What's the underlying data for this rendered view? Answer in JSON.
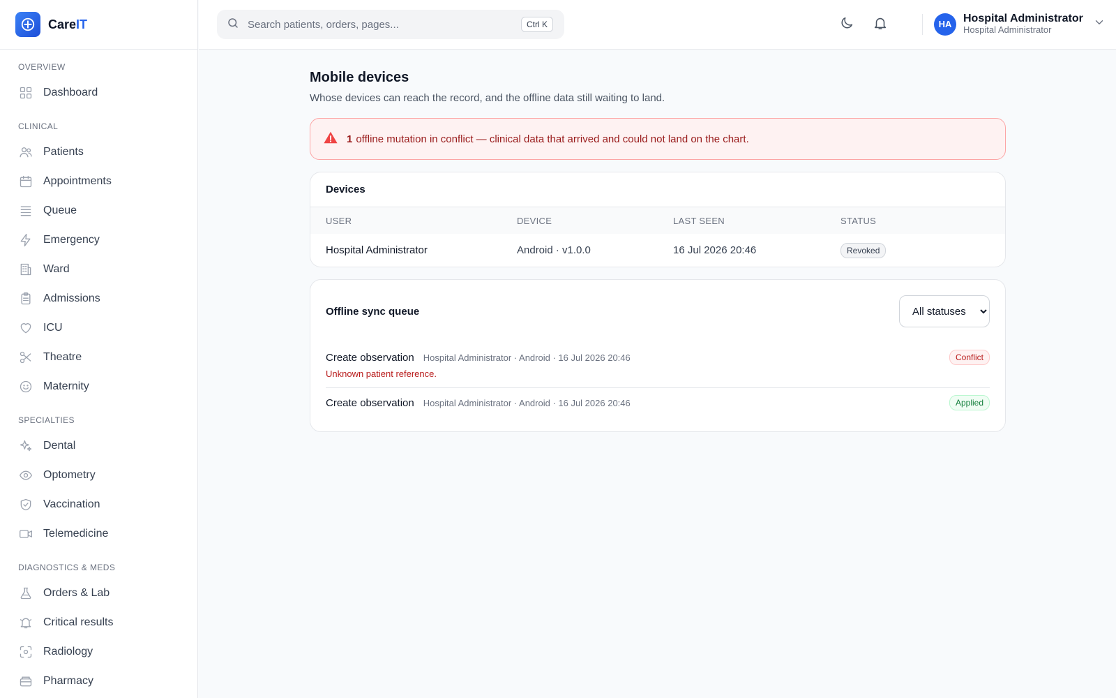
{
  "brand": {
    "name_prefix": "Care",
    "name_suffix": "IT"
  },
  "search": {
    "placeholder": "Search patients, orders, pages...",
    "shortcut": "Ctrl K"
  },
  "user": {
    "initials": "HA",
    "name": "Hospital Administrator",
    "role": "Hospital Administrator"
  },
  "sidebar": {
    "sections": [
      {
        "heading": "OVERVIEW",
        "items": [
          {
            "label": "Dashboard",
            "icon": "dashboard-icon"
          }
        ]
      },
      {
        "heading": "CLINICAL",
        "items": [
          {
            "label": "Patients",
            "icon": "users-icon"
          },
          {
            "label": "Appointments",
            "icon": "calendar-icon"
          },
          {
            "label": "Queue",
            "icon": "list-icon"
          },
          {
            "label": "Emergency",
            "icon": "lightning-icon"
          },
          {
            "label": "Ward",
            "icon": "building-icon"
          },
          {
            "label": "Admissions",
            "icon": "clipboard-icon"
          },
          {
            "label": "ICU",
            "icon": "heart-icon"
          },
          {
            "label": "Theatre",
            "icon": "scissors-icon"
          },
          {
            "label": "Maternity",
            "icon": "smile-icon"
          }
        ]
      },
      {
        "heading": "SPECIALTIES",
        "items": [
          {
            "label": "Dental",
            "icon": "sparkles-icon"
          },
          {
            "label": "Optometry",
            "icon": "eye-icon"
          },
          {
            "label": "Vaccination",
            "icon": "shield-check-icon"
          },
          {
            "label": "Telemedicine",
            "icon": "video-icon"
          }
        ]
      },
      {
        "heading": "DIAGNOSTICS & MEDS",
        "items": [
          {
            "label": "Orders & Lab",
            "icon": "flask-icon"
          },
          {
            "label": "Critical results",
            "icon": "bell-alert-icon"
          },
          {
            "label": "Radiology",
            "icon": "scan-icon"
          },
          {
            "label": "Pharmacy",
            "icon": "pill-box-icon"
          }
        ]
      }
    ]
  },
  "page": {
    "title": "Mobile devices",
    "subtitle": "Whose devices can reach the record, and the offline data still waiting to land."
  },
  "alert": {
    "count": "1",
    "message": "offline mutation in conflict — clinical data that arrived and could not land on the chart."
  },
  "devices": {
    "title": "Devices",
    "columns": [
      "USER",
      "DEVICE",
      "LAST SEEN",
      "STATUS"
    ],
    "rows": [
      {
        "user": "Hospital Administrator",
        "device": "Android · v1.0.0",
        "last_seen": "16 Jul 2026 20:46",
        "status": "Revoked"
      }
    ]
  },
  "queue": {
    "title": "Offline sync queue",
    "filter_selected": "All statuses",
    "items": [
      {
        "title": "Create observation",
        "meta": "Hospital Administrator · Android · 16 Jul 2026 20:46",
        "status": "Conflict",
        "error": "Unknown patient reference."
      },
      {
        "title": "Create observation",
        "meta": "Hospital Administrator · Android · 16 Jul 2026 20:46",
        "status": "Applied",
        "error": ""
      }
    ]
  },
  "colors": {
    "accent": "#2563eb",
    "conflict": "#b91c1c",
    "applied": "#15803d",
    "alert_bg": "#fef2f2"
  }
}
